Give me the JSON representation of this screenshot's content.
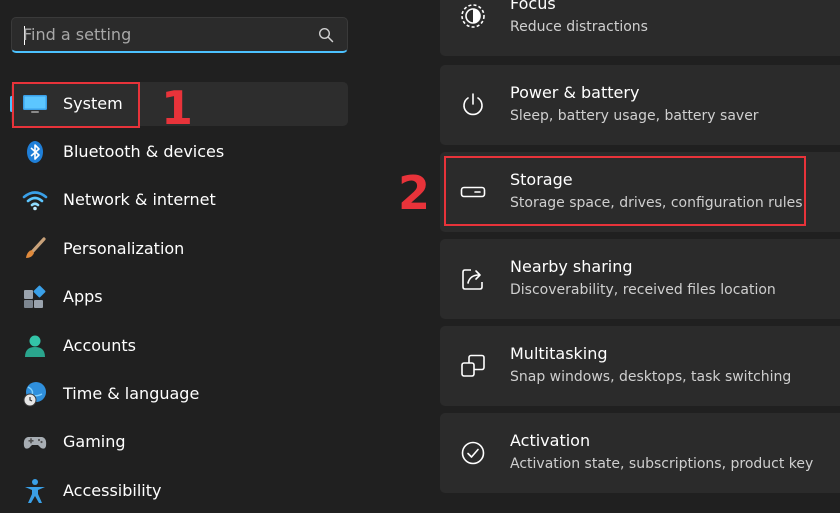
{
  "search": {
    "placeholder": "Find a setting",
    "icon": "search-icon"
  },
  "sidebar": {
    "items": [
      {
        "label": "System",
        "icon": "monitor-icon"
      },
      {
        "label": "Bluetooth & devices",
        "icon": "bluetooth-icon"
      },
      {
        "label": "Network & internet",
        "icon": "wifi-icon"
      },
      {
        "label": "Personalization",
        "icon": "brush-icon"
      },
      {
        "label": "Apps",
        "icon": "apps-icon"
      },
      {
        "label": "Accounts",
        "icon": "person-icon"
      },
      {
        "label": "Time & language",
        "icon": "globe-clock-icon"
      },
      {
        "label": "Gaming",
        "icon": "gamepad-icon"
      },
      {
        "label": "Accessibility",
        "icon": "accessibility-icon"
      }
    ]
  },
  "cards": [
    {
      "title": "Focus",
      "subtitle": "Reduce distractions",
      "icon": "focus-icon"
    },
    {
      "title": "Power & battery",
      "subtitle": "Sleep, battery usage, battery saver",
      "icon": "power-icon"
    },
    {
      "title": "Storage",
      "subtitle": "Storage space, drives, configuration rules",
      "icon": "storage-drive-icon"
    },
    {
      "title": "Nearby sharing",
      "subtitle": "Discoverability, received files location",
      "icon": "share-icon"
    },
    {
      "title": "Multitasking",
      "subtitle": "Snap windows, desktops, task switching",
      "icon": "multitasking-icon"
    },
    {
      "title": "Activation",
      "subtitle": "Activation state, subscriptions, product key",
      "icon": "check-circle-icon"
    }
  ],
  "annotations": {
    "step1": "1",
    "step2": "2"
  },
  "colors": {
    "background": "#202020",
    "card": "#2b2b2b",
    "accent": "#4cc2ff",
    "highlight": "#e8333a"
  }
}
